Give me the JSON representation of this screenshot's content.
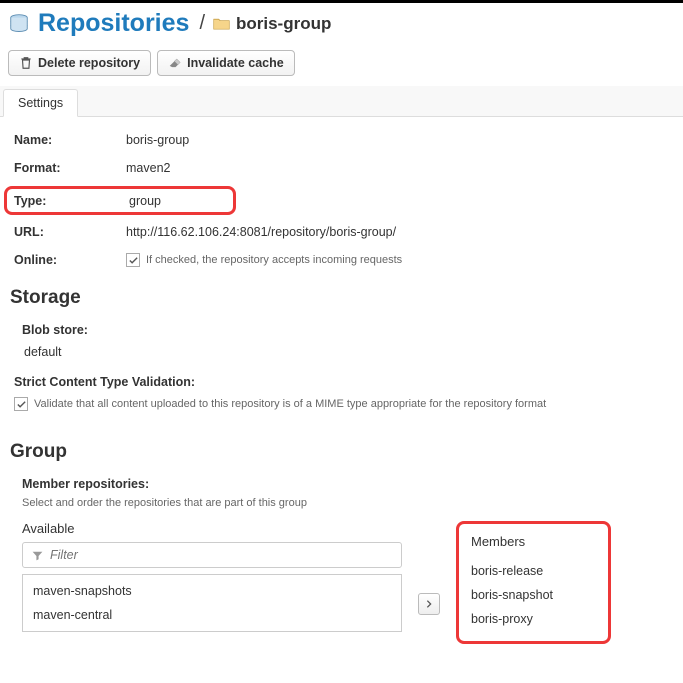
{
  "header": {
    "title": "Repositories",
    "breadcrumb_sep": "/",
    "repo_name": "boris-group"
  },
  "toolbar": {
    "delete_label": "Delete repository",
    "invalidate_label": "Invalidate cache"
  },
  "tabs": {
    "settings": "Settings"
  },
  "props": {
    "name_label": "Name:",
    "name_value": "boris-group",
    "format_label": "Format:",
    "format_value": "maven2",
    "type_label": "Type:",
    "type_value": "group",
    "url_label": "URL:",
    "url_value": "http://116.62.106.24:8081/repository/boris-group/",
    "online_label": "Online:",
    "online_help": "If checked, the repository accepts incoming requests"
  },
  "storage": {
    "title": "Storage",
    "blob_label": "Blob store:",
    "blob_value": "default",
    "strict_label": "Strict Content Type Validation:",
    "strict_help": "Validate that all content uploaded to this repository is of a MIME type appropriate for the repository format"
  },
  "group": {
    "title": "Group",
    "members_label": "Member repositories:",
    "members_sub": "Select and order the repositories that are part of this group",
    "available_head": "Available",
    "members_head": "Members",
    "filter_placeholder": "Filter",
    "available": [
      "maven-snapshots",
      "maven-central"
    ],
    "members": [
      "boris-release",
      "boris-snapshot",
      "boris-proxy"
    ]
  }
}
